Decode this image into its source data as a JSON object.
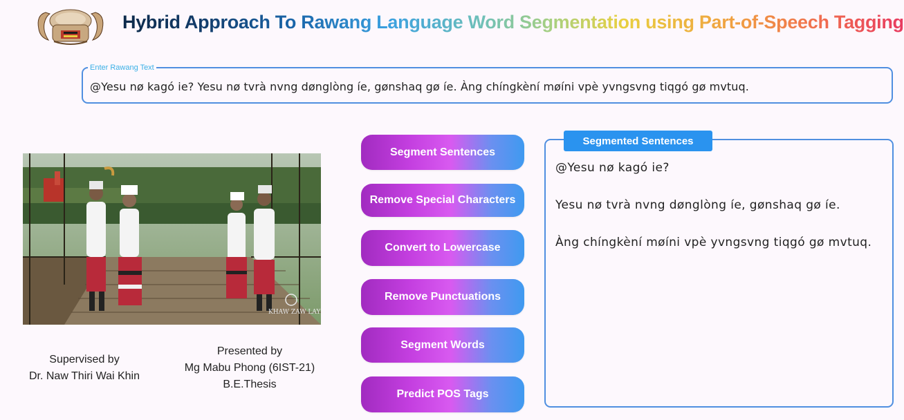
{
  "header": {
    "title": "Hybrid Approach To Rawang Language Word Segmentation using Part-of-Speech Tagging"
  },
  "input": {
    "label": "Enter Rawang Text",
    "value": "@Yesu nø kagó ie? Yesu nø tvrà nvng dønglòng íe, gønshaq gø íe. Àng chíngkèní møíni vpè yvngsvng tiqgó gø mvtuq."
  },
  "credits": {
    "supervised_label": "Supervised by",
    "supervisor": "Dr. Naw Thiri Wai Khin",
    "presented_label": "Presented by",
    "author": "Mg Mabu Phong (6IST-21)",
    "thesis": "B.E.Thesis"
  },
  "photo": {
    "watermark": "KHAW ZAW LAY"
  },
  "buttons": {
    "segment_sentences": "Segment Sentences",
    "remove_special": "Remove Special Characters",
    "lowercase": "Convert to Lowercase",
    "remove_punct": "Remove Punctuations",
    "segment_words": "Segment Words",
    "predict_pos": "Predict POS Tags"
  },
  "output": {
    "title": "Segmented Sentences",
    "lines": [
      "@Yesu nø kagó ie?",
      "Yesu nø tvrà nvng dønglòng íe, gønshaq gø íe.",
      "Àng chíngkèní møíni vpè yvngsvng tiqgó gø mvtuq."
    ]
  },
  "colors": {
    "accent": "#4f8fe0",
    "tab": "#2a93ef",
    "button_start": "#a12bc0",
    "button_end": "#3f9af0"
  }
}
